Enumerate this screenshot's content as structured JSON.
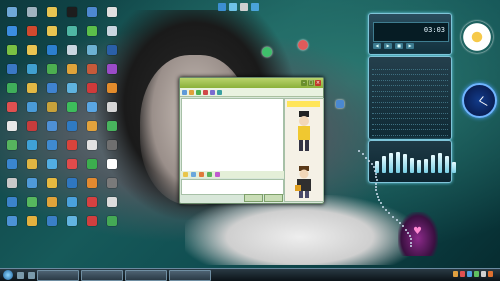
{
  "desktop": {
    "icons": [
      {
        "name": "computer-icon",
        "color": "#6ea8d8"
      },
      {
        "name": "recycle-bin-icon",
        "color": "#9fb3bf"
      },
      {
        "name": "folder-icon",
        "color": "#e8c451"
      },
      {
        "name": "terminal-icon",
        "color": "#1d1d1d"
      },
      {
        "name": "network-icon",
        "color": "#4d88d0"
      },
      {
        "name": "document-icon",
        "color": "#e0e0e0"
      },
      {
        "name": "ie-icon",
        "color": "#3b8de0"
      },
      {
        "name": "media-icon",
        "color": "#d1492e"
      },
      {
        "name": "folder-icon",
        "color": "#e8c451"
      },
      {
        "name": "music-icon",
        "color": "#4fb6a3"
      },
      {
        "name": "chat-icon",
        "color": "#5bbf4a"
      },
      {
        "name": "document-icon",
        "color": "#c9d6e0"
      },
      {
        "name": "game-icon",
        "color": "#7ac043"
      },
      {
        "name": "folder-icon",
        "color": "#e8c451"
      },
      {
        "name": "globe-icon",
        "color": "#2c7fcf"
      },
      {
        "name": "document-icon",
        "color": "#c9d6e0"
      },
      {
        "name": "photo-icon",
        "color": "#6cb1d3"
      },
      {
        "name": "app-icon",
        "color": "#2a5fa8"
      },
      {
        "name": "player-icon",
        "color": "#3a78c5"
      },
      {
        "name": "app-icon",
        "color": "#40a0d0"
      },
      {
        "name": "download-icon",
        "color": "#4caf50"
      },
      {
        "name": "app-icon",
        "color": "#e0a43a"
      },
      {
        "name": "app-icon",
        "color": "#c65a3a"
      },
      {
        "name": "app-icon",
        "color": "#9a4bc8"
      },
      {
        "name": "app-icon",
        "color": "#3fae5a"
      },
      {
        "name": "app-icon",
        "color": "#e2b844"
      },
      {
        "name": "app-icon",
        "color": "#3f83cf"
      },
      {
        "name": "app-icon",
        "color": "#5fb3df"
      },
      {
        "name": "app-icon",
        "color": "#d03a3a"
      },
      {
        "name": "app-icon",
        "color": "#e28b2c"
      },
      {
        "name": "app-icon",
        "color": "#e05050"
      },
      {
        "name": "app-icon",
        "color": "#4a9bd8"
      },
      {
        "name": "app-icon",
        "color": "#c8a23a"
      },
      {
        "name": "app-icon",
        "color": "#3dbd5b"
      },
      {
        "name": "app-icon",
        "color": "#5aa6e3"
      },
      {
        "name": "app-icon",
        "color": "#d6d6d6"
      },
      {
        "name": "app-icon",
        "color": "#e8e8e8"
      },
      {
        "name": "app-icon",
        "color": "#c73c3c"
      },
      {
        "name": "app-icon",
        "color": "#4e90d5"
      },
      {
        "name": "app-icon",
        "color": "#2f7ac2"
      },
      {
        "name": "app-icon",
        "color": "#e2a23c"
      },
      {
        "name": "app-icon",
        "color": "#48b35d"
      },
      {
        "name": "app-icon",
        "color": "#56b45e"
      },
      {
        "name": "app-icon",
        "color": "#3fa1d6"
      },
      {
        "name": "app-icon",
        "color": "#3f8ad0"
      },
      {
        "name": "app-icon",
        "color": "#d9433b"
      },
      {
        "name": "app-icon",
        "color": "#e2e2e2"
      },
      {
        "name": "app-icon",
        "color": "#6f6f6f"
      },
      {
        "name": "app-icon",
        "color": "#3a86cf"
      },
      {
        "name": "app-icon",
        "color": "#e0b542"
      },
      {
        "name": "app-icon",
        "color": "#52aee3"
      },
      {
        "name": "app-icon",
        "color": "#e04b4b"
      },
      {
        "name": "app-icon",
        "color": "#3cae4e"
      },
      {
        "name": "app-icon",
        "color": "#ffffff"
      },
      {
        "name": "app-icon",
        "color": "#c9c9c9"
      },
      {
        "name": "app-icon",
        "color": "#4f9ad8"
      },
      {
        "name": "app-icon",
        "color": "#e5b940"
      },
      {
        "name": "app-icon",
        "color": "#2f77c0"
      },
      {
        "name": "app-icon",
        "color": "#e28a30"
      },
      {
        "name": "app-icon",
        "color": "#7a7a7a"
      },
      {
        "name": "app-icon",
        "color": "#3b83ca"
      },
      {
        "name": "app-icon",
        "color": "#56b75e"
      },
      {
        "name": "app-icon",
        "color": "#e0a33a"
      },
      {
        "name": "app-icon",
        "color": "#4aa1dc"
      },
      {
        "name": "app-icon",
        "color": "#d54141"
      },
      {
        "name": "app-icon",
        "color": "#dcdcdc"
      },
      {
        "name": "app-icon",
        "color": "#4c92d5"
      },
      {
        "name": "app-icon",
        "color": "#e3b13f"
      },
      {
        "name": "app-icon",
        "color": "#3a7fc6"
      },
      {
        "name": "app-icon",
        "color": "#62b4e0"
      },
      {
        "name": "app-icon",
        "color": "#cf3f3f"
      },
      {
        "name": "app-icon",
        "color": "#44a955"
      }
    ]
  },
  "qq_window": {
    "title": "",
    "send_label": "",
    "close_label": "",
    "banner": ""
  },
  "player": {
    "title": "",
    "time": "03:03"
  },
  "playlist": {
    "title": "",
    "row_count": 14
  },
  "equalizer": {
    "levels": [
      0.55,
      0.75,
      0.9,
      0.95,
      0.85,
      0.7,
      0.6,
      0.65,
      0.8,
      0.9,
      0.75,
      0.5
    ]
  },
  "taskbar": {
    "buttons": [
      "",
      "",
      "",
      ""
    ],
    "clock": ""
  },
  "colors": {
    "qq_title": "#8bb03b",
    "player_glow": "#6bd1ea",
    "taskbar": "#0b1318"
  }
}
